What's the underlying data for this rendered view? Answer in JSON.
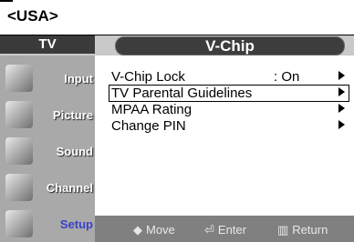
{
  "region_label": "<USA>",
  "header": {
    "tv_label": "TV",
    "title": "V-Chip"
  },
  "sidebar": {
    "items": [
      {
        "label": "Input",
        "icon": "input-icon"
      },
      {
        "label": "Picture",
        "icon": "picture-icon"
      },
      {
        "label": "Sound",
        "icon": "sound-icon"
      },
      {
        "label": "Channel",
        "icon": "channel-icon"
      },
      {
        "label": "Setup",
        "icon": "setup-icon",
        "active": true
      }
    ]
  },
  "menu": {
    "items": [
      {
        "label": "V-Chip Lock",
        "value": ": On"
      },
      {
        "label": "TV Parental Guidelines",
        "value": ""
      },
      {
        "label": "MPAA Rating",
        "value": ""
      },
      {
        "label": "Change PIN",
        "value": ""
      }
    ]
  },
  "footer": {
    "move": {
      "icon": "◆",
      "label": "Move"
    },
    "enter": {
      "icon": "⏎",
      "label": "Enter"
    },
    "return": {
      "icon": "▥",
      "label": "Return"
    }
  },
  "colors": {
    "active_label": "#3a42c8",
    "frame": "#c9c9c9",
    "bar": "#808080"
  }
}
